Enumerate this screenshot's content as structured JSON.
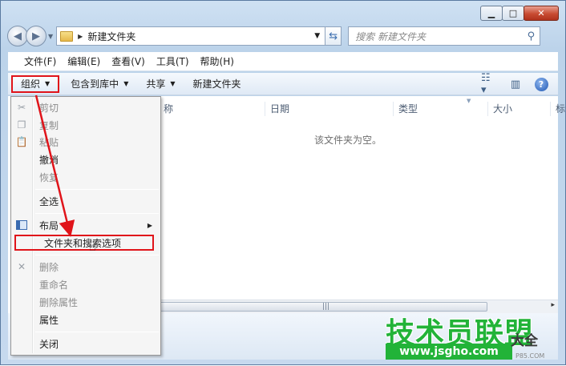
{
  "window": {
    "caption": {
      "minimize": "▭",
      "maximize": "□",
      "close": "✕"
    }
  },
  "nav": {
    "back_icon": "back-arrow-icon",
    "forward_icon": "forward-arrow-icon",
    "path": "新建文件夹",
    "search_placeholder": "搜索 新建文件夹"
  },
  "menubar": [
    "文件(F)",
    "编辑(E)",
    "查看(V)",
    "工具(T)",
    "帮助(H)"
  ],
  "toolbar": {
    "organize": "组织",
    "include_library": "包含到库中",
    "share": "共享",
    "new_folder": "新建文件夹",
    "help": "?"
  },
  "columns": {
    "name_partial": "称",
    "date": "日期",
    "type": "类型",
    "size": "大小",
    "more": "标"
  },
  "empty_message": "该文件夹为空。",
  "organize_menu": {
    "cut": "剪切",
    "copy": "复制",
    "paste": "粘贴",
    "undo": "撤消",
    "redo": "恢复",
    "select_all": "全选",
    "layout": "布局",
    "folder_options": "文件夹和搜索选项",
    "delete": "删除",
    "rename": "重命名",
    "remove_props": "删除属性",
    "properties": "属性",
    "close": "关闭"
  },
  "watermark": {
    "title": "技术员联盟",
    "url": "www.jsgho.com",
    "side": "大全",
    "small": "P85.COM"
  },
  "colors": {
    "highlight_red": "#e0141a",
    "watermark_green": "#22b338"
  }
}
